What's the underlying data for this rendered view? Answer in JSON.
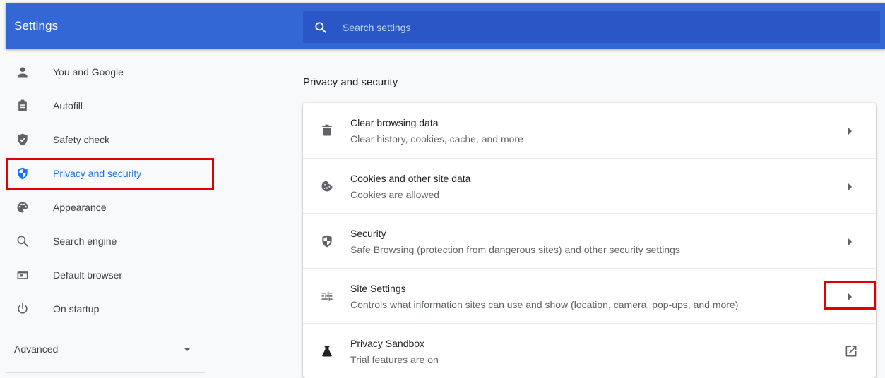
{
  "app": {
    "title": "Settings"
  },
  "search": {
    "placeholder": "Search settings",
    "value": ""
  },
  "sidebar": {
    "items": [
      {
        "label": "You and Google",
        "icon": "person-icon"
      },
      {
        "label": "Autofill",
        "icon": "clipboard-icon"
      },
      {
        "label": "Safety check",
        "icon": "shield-check-icon"
      },
      {
        "label": "Privacy and security",
        "icon": "shield-half-icon",
        "active": true
      },
      {
        "label": "Appearance",
        "icon": "palette-icon"
      },
      {
        "label": "Search engine",
        "icon": "search-icon"
      },
      {
        "label": "Default browser",
        "icon": "browser-window-icon"
      },
      {
        "label": "On startup",
        "icon": "power-icon"
      }
    ],
    "advanced_label": "Advanced"
  },
  "main": {
    "section_title": "Privacy and security",
    "rows": [
      {
        "title": "Clear browsing data",
        "subtitle": "Clear history, cookies, cache, and more",
        "icon": "trash-icon",
        "action": "arrow"
      },
      {
        "title": "Cookies and other site data",
        "subtitle": "Cookies are allowed",
        "icon": "cookie-icon",
        "action": "arrow"
      },
      {
        "title": "Security",
        "subtitle": "Safe Browsing (protection from dangerous sites) and other security settings",
        "icon": "shield-half-icon",
        "action": "arrow"
      },
      {
        "title": "Site Settings",
        "subtitle": "Controls what information sites can use and show (location, camera, pop-ups, and more)",
        "icon": "tune-sliders-icon",
        "action": "arrow"
      },
      {
        "title": "Privacy Sandbox",
        "subtitle": "Trial features are on",
        "icon": "flask-icon",
        "action": "external"
      }
    ]
  },
  "colors": {
    "header_bg": "#3367d6",
    "search_bg": "#2a56c6",
    "accent": "#1a73e8",
    "highlight": "#e00000"
  }
}
